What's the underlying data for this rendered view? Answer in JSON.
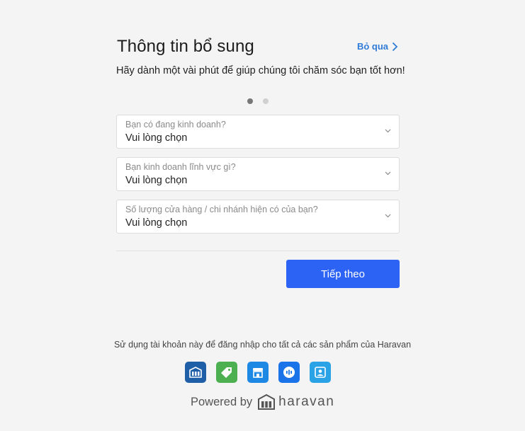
{
  "header": {
    "title": "Thông tin bổ sung",
    "skip_label": "Bỏ qua"
  },
  "subtitle": "Hãy dành một vài phút để giúp chúng tôi chăm sóc bạn tốt hơn!",
  "steps": {
    "current": 1,
    "total": 2
  },
  "form": {
    "fields": [
      {
        "label": "Bạn có đang kinh doanh?",
        "value": "Vui lòng chọn"
      },
      {
        "label": "Bạn kinh doanh lĩnh vực gì?",
        "value": "Vui lòng chọn"
      },
      {
        "label": "Số lượng cửa hàng / chi nhánh hiện có của bạn?",
        "value": "Vui lòng chọn"
      }
    ],
    "next_label": "Tiếp theo"
  },
  "footer": {
    "note": "Sử dụng tài khoản này để đăng nhập cho tất cả các sản phẩm của Haravan",
    "apps": [
      {
        "icon": "haravan-app-icon",
        "color": "#1f5fa8"
      },
      {
        "icon": "tag-app-icon",
        "color": "#4caf50"
      },
      {
        "icon": "store-app-icon",
        "color": "#1e88e5"
      },
      {
        "icon": "chat-app-icon",
        "color": "#1a73e8"
      },
      {
        "icon": "contact-app-icon",
        "color": "#29a3e6"
      }
    ],
    "powered_by": "Powered by",
    "brand": "haravan"
  },
  "colors": {
    "primary": "#2c63f5",
    "link": "#2f7bd8",
    "background": "#f4f4f4"
  }
}
